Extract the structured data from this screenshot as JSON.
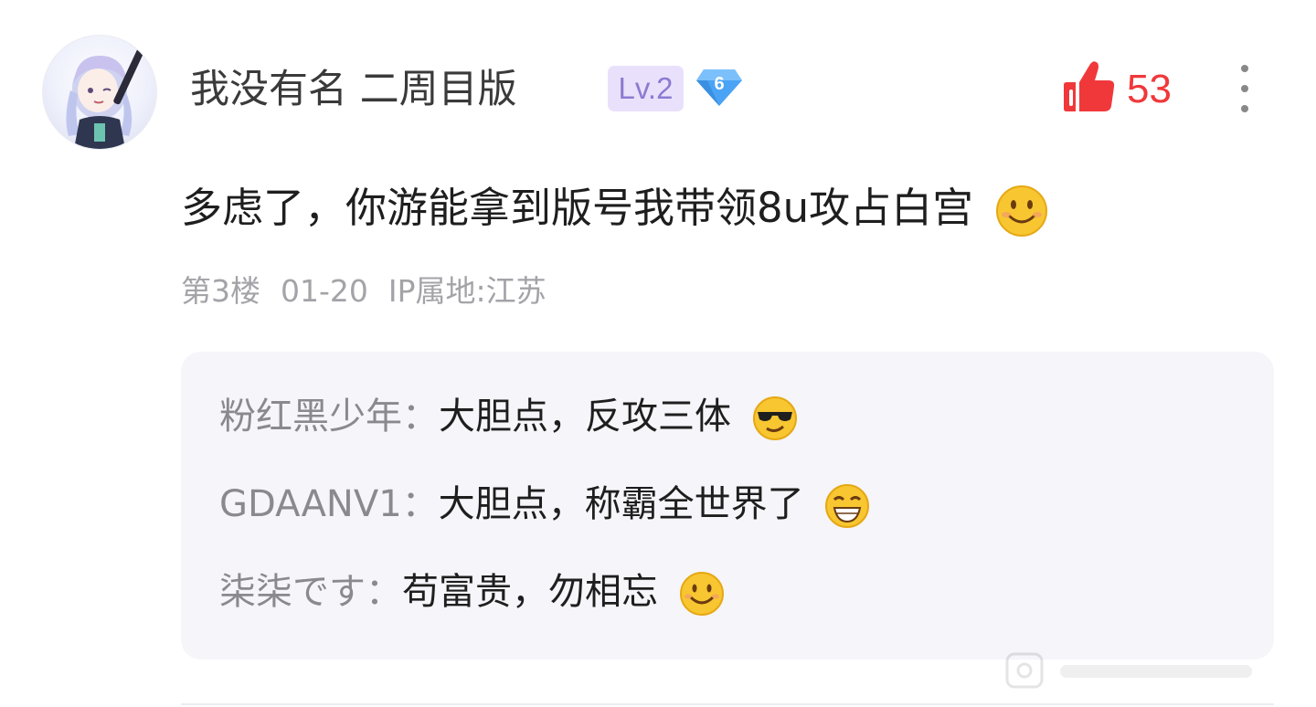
{
  "post": {
    "username": "我没有名  二周目版",
    "level": "Lv.2",
    "gem_level": "6",
    "likes": "53",
    "content": "多虑了，你游能拿到版号我带领8u攻占白宫",
    "floor": "第3楼",
    "date": "01-20",
    "ip_location": "IP属地:江苏"
  },
  "replies": [
    {
      "author": "粉红黑少年：",
      "text": "大胆点，反攻三体",
      "emoji": "cool-emoji"
    },
    {
      "author": "GDAANV1：",
      "text": "大胆点，称霸全世界了",
      "emoji": "grin-emoji"
    },
    {
      "author": "柒柒です：",
      "text": "苟富贵，勿相忘",
      "emoji": "smile-emoji"
    }
  ],
  "colors": {
    "like_red": "#f0383a",
    "level_badge_bg": "#e9e1fb",
    "level_badge_text": "#8b7bd1",
    "gem_blue": "#4aa3f5",
    "reply_bg": "#f5f5fa",
    "meta_gray": "#a3a3a8"
  },
  "icons": [
    "avatar",
    "diamond-gem-icon",
    "thumbs-up-icon",
    "more-vertical-icon"
  ]
}
